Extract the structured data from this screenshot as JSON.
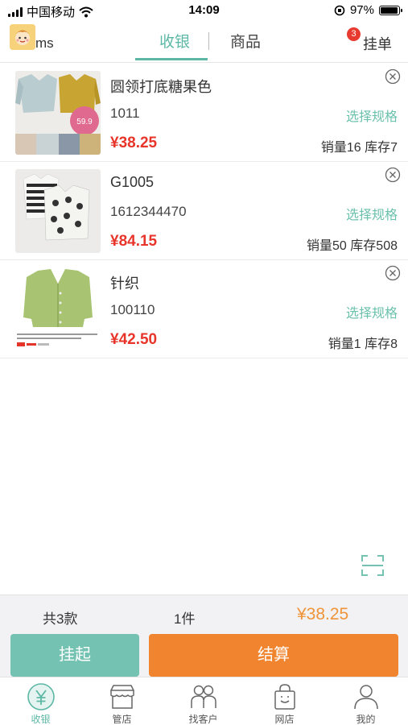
{
  "status_bar": {
    "carrier": "中国移动",
    "time": "14:09",
    "battery": "97%",
    "battery_level": 0.97
  },
  "header": {
    "user_name": "ms",
    "tab_cashier": "收银",
    "tab_cashier_badge": "3",
    "tab_products": "商品",
    "hang_order": "挂单"
  },
  "products": [
    {
      "name": "圆领打底糖果色",
      "code": "1011",
      "price": "¥38.25",
      "spec": "选择规格",
      "sales": "销量16",
      "stock": "库存7",
      "badge_price": "59.9",
      "image": "sweaters-photo"
    },
    {
      "name": "G1005",
      "code": "1612344470",
      "price": "¥84.15",
      "spec": "选择规格",
      "sales": "销量50",
      "stock": "库存508",
      "image": "striped-tops-photo"
    },
    {
      "name": "针织",
      "code": "100110",
      "price": "¥42.50",
      "spec": "选择规格",
      "sales": "销量1",
      "stock": "库存8",
      "image": "green-cardigan-photo"
    }
  ],
  "summary": {
    "count": "共3款",
    "quantity": "1件",
    "total": "¥38.25"
  },
  "actions": {
    "hold": "挂起",
    "checkout": "结算"
  },
  "nav": [
    {
      "label": "收银",
      "icon": "yuan-icon",
      "active": true
    },
    {
      "label": "管店",
      "icon": "store-icon",
      "active": false
    },
    {
      "label": "找客户",
      "icon": "customers-icon",
      "active": false
    },
    {
      "label": "网店",
      "icon": "shopping-bag-icon",
      "active": false
    },
    {
      "label": "我的",
      "icon": "profile-icon",
      "active": false
    }
  ],
  "colors": {
    "accent": "#5cb8a5",
    "price": "#e8352b",
    "checkout": "#f0842f",
    "hold": "#74c2b2",
    "total": "#f0943a"
  }
}
